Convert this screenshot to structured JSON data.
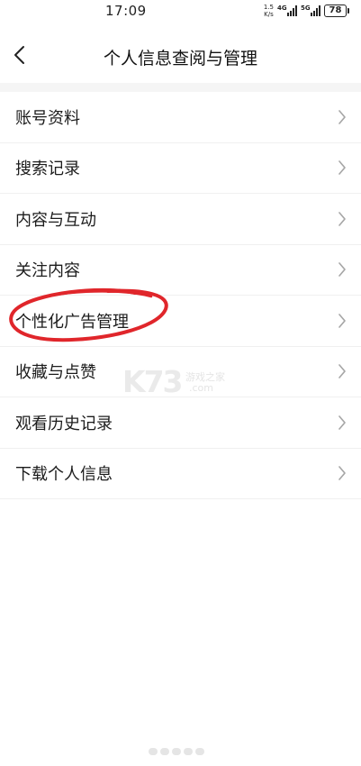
{
  "status_bar": {
    "time": "17:09",
    "net_speed_value": "1.5",
    "net_speed_unit": "K/s",
    "signal_1_label": "4G",
    "signal_2_label": "5G",
    "battery": "78"
  },
  "header": {
    "title": "个人信息查阅与管理"
  },
  "menu": {
    "items": [
      {
        "label": "账号资料"
      },
      {
        "label": "搜索记录"
      },
      {
        "label": "内容与互动"
      },
      {
        "label": "关注内容"
      },
      {
        "label": "个性化广告管理"
      },
      {
        "label": "收藏与点赞"
      },
      {
        "label": "观看历史记录"
      },
      {
        "label": "下载个人信息"
      }
    ]
  },
  "watermark": {
    "logo": "K73",
    "line1": "游戏之家",
    "line2": ".com"
  },
  "colors": {
    "annotation": "#e0262b",
    "chevron": "#a6a6a6",
    "band": "#f5f5f5"
  }
}
